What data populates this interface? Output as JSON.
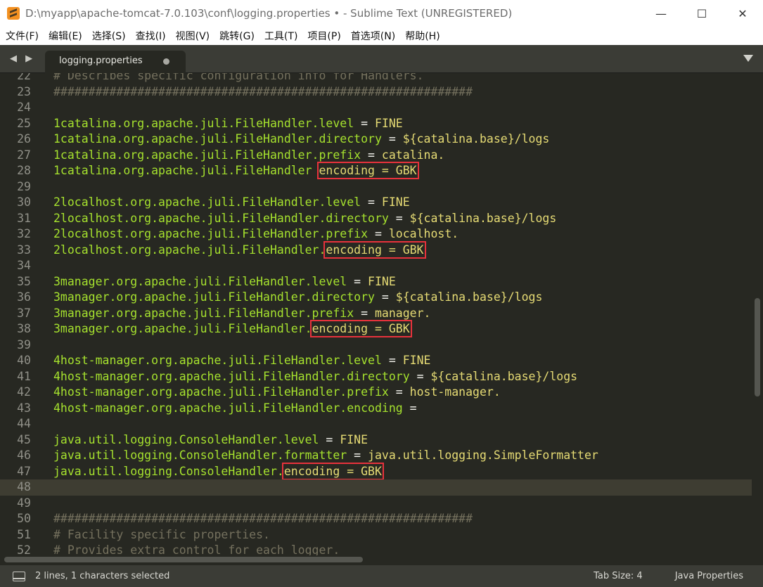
{
  "window": {
    "title": "D:\\myapp\\apache-tomcat-7.0.103\\conf\\logging.properties • - Sublime Text (UNREGISTERED)",
    "minimize": "—",
    "maximize": "☐",
    "close": "✕"
  },
  "menu": [
    "文件(F)",
    "编辑(E)",
    "选择(S)",
    "查找(I)",
    "视图(V)",
    "跳转(G)",
    "工具(T)",
    "项目(P)",
    "首选项(N)",
    "帮助(H)"
  ],
  "tabs": {
    "nav": "◀ ▶",
    "active_label": "logging.properties"
  },
  "editor": {
    "current_line": 48,
    "lines": [
      {
        "n": "22",
        "text": "# Describes specific configuration info for Handlers."
      },
      {
        "n": "23",
        "text": "############################################################"
      },
      {
        "n": "24",
        "text": ""
      },
      {
        "n": "25",
        "pre": "1catalina.org.apache.juli.FileHandler.level",
        "eq": " = ",
        "val": "FINE"
      },
      {
        "n": "26",
        "pre": "1catalina.org.apache.juli.FileHandler.directory",
        "eq": " = ",
        "val": "${catalina.base}/logs"
      },
      {
        "n": "27",
        "pre": "1catalina.org.apache.juli.FileHandler.prefix",
        "eq": " = ",
        "val": "catalina."
      },
      {
        "n": "28",
        "pre": "1catalina.org.apache.juli.FileHandler ",
        "hl": "encoding = GBK"
      },
      {
        "n": "29",
        "text": ""
      },
      {
        "n": "30",
        "pre": "2localhost.org.apache.juli.FileHandler.level",
        "eq": " = ",
        "val": "FINE"
      },
      {
        "n": "31",
        "pre": "2localhost.org.apache.juli.FileHandler.directory",
        "eq": " = ",
        "val": "${catalina.base}/logs"
      },
      {
        "n": "32",
        "pre": "2localhost.org.apache.juli.FileHandler.prefix",
        "eq": " = ",
        "val": "localhost."
      },
      {
        "n": "33",
        "pre": "2localhost.org.apache.juli.FileHandler.",
        "hl": "encoding = GBK"
      },
      {
        "n": "34",
        "text": ""
      },
      {
        "n": "35",
        "pre": "3manager.org.apache.juli.FileHandler.level",
        "eq": " = ",
        "val": "FINE"
      },
      {
        "n": "36",
        "pre": "3manager.org.apache.juli.FileHandler.directory",
        "eq": " = ",
        "val": "${catalina.base}/logs"
      },
      {
        "n": "37",
        "pre": "3manager.org.apache.juli.FileHandler.prefix",
        "eq": " = ",
        "val": "manager."
      },
      {
        "n": "38",
        "pre": "3manager.org.apache.juli.FileHandler.",
        "hl": "encoding = GBK"
      },
      {
        "n": "39",
        "text": ""
      },
      {
        "n": "40",
        "pre": "4host-manager.org.apache.juli.FileHandler.level",
        "eq": " = ",
        "val": "FINE"
      },
      {
        "n": "41",
        "pre": "4host-manager.org.apache.juli.FileHandler.directory",
        "eq": " = ",
        "val": "${catalina.base}/logs"
      },
      {
        "n": "42",
        "pre": "4host-manager.org.apache.juli.FileHandler.prefix",
        "eq": " = ",
        "val": "host-manager."
      },
      {
        "n": "43",
        "pre": "4host-manager.org.apache.juli.FileHandler.encoding",
        "eq": " = ",
        "val": ""
      },
      {
        "n": "44",
        "text": ""
      },
      {
        "n": "45",
        "pre": "java.util.logging.ConsoleHandler.level",
        "eq": " = ",
        "val": "FINE"
      },
      {
        "n": "46",
        "pre": "java.util.logging.ConsoleHandler.formatter",
        "eq": " = ",
        "val": "java.util.logging.SimpleFormatter"
      },
      {
        "n": "47",
        "pre": "java.util.logging.ConsoleHandler.",
        "hl": "encoding = GBK"
      },
      {
        "n": "48",
        "text": ""
      },
      {
        "n": "49",
        "text": ""
      },
      {
        "n": "50",
        "text": "############################################################"
      },
      {
        "n": "51",
        "text": "# Facility specific properties."
      },
      {
        "n": "52",
        "text": "# Provides extra control for each logger."
      }
    ]
  },
  "status": {
    "selection": "2 lines, 1 characters selected",
    "tab_size": "Tab Size: 4",
    "syntax": "Java Properties"
  },
  "colors": {
    "background": "#272822",
    "highlight_box": "#e8323c",
    "key": "#a6e22e",
    "value": "#e6db74",
    "comment": "#75715e"
  }
}
